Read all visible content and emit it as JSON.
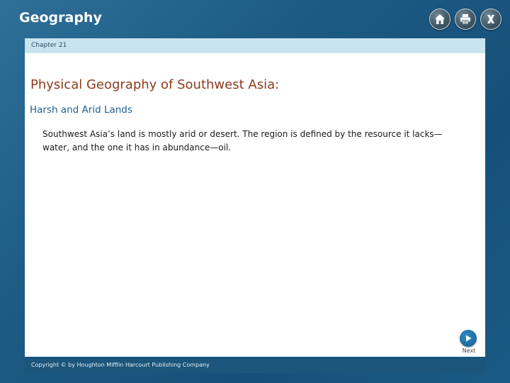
{
  "app": {
    "title": "Geography"
  },
  "toolbar": {
    "home_icon": "home-icon",
    "print_icon": "print-icon",
    "close_icon": "close-icon",
    "close_glyph": "X"
  },
  "chapter": {
    "label": "Chapter 21"
  },
  "content": {
    "heading": "Physical Geography of Southwest Asia:",
    "subheading": "Harsh and Arid Lands",
    "body": "Southwest Asia’s land is mostly arid or desert. The region is defined by the resource it lacks—water, and the one it has in abundance—oil."
  },
  "navigation": {
    "next_label": "Next",
    "next_icon": "play-arrow-icon"
  },
  "footer": {
    "copyright": "Copyright © by Houghton Mifflin Harcourt Publishing Company"
  },
  "colors": {
    "background": "#1d5b84",
    "chapter_bar": "#c9e3f0",
    "heading": "#8c3b1d",
    "subheading": "#1f5f8a",
    "footer": "#1b557c"
  }
}
